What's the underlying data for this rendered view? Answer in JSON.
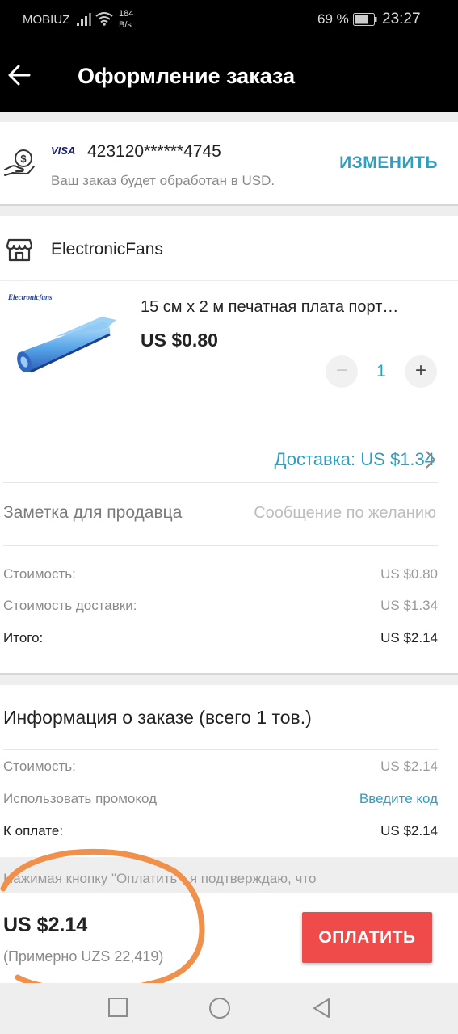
{
  "status_bar": {
    "carrier": "MOBIUZ",
    "speed_value": "184",
    "speed_unit": "B/s",
    "battery_percent": "69 %",
    "time": "23:27"
  },
  "header": {
    "title": "Оформление заказа",
    "back_icon": "arrow-left-icon"
  },
  "payment": {
    "card_brand": "VISA",
    "card_number": "423120******4745",
    "note": "Ваш заказ будет обработан в USD.",
    "change_label": "ИЗМЕНИТЬ",
    "icon": "hand-coin-icon"
  },
  "order": {
    "store_name": "ElectronicFans",
    "store_icon": "store-icon",
    "product": {
      "image_brand": "Electronicfans",
      "title": "15 см x 2 м печатная плата порт…",
      "price": "US $0.80",
      "quantity": "1",
      "minus": "−",
      "plus": "+"
    },
    "shipping": "Доставка: US $1.34",
    "seller_note": {
      "label": "Заметка для продавца",
      "placeholder": "Сообщение по желанию",
      "value": ""
    },
    "summary": [
      {
        "label": "Стоимость:",
        "value": "US $0.80"
      },
      {
        "label": "Стоимость доставки:",
        "value": "US $1.34"
      },
      {
        "label": "Итого:",
        "value": "US $2.14"
      }
    ]
  },
  "order_info": {
    "title": "Информация о заказе (всего 1 тов.)",
    "cost_label": "Стоимость:",
    "cost_value": "US $2.14",
    "promo_label": "Использовать промокод",
    "promo_link": "Введите код",
    "to_pay_label": "К оплате:",
    "to_pay_value": "US $2.14"
  },
  "terms_text": "Нажимая кнопку \"Оплатить\", я подтверждаю, что",
  "bottom_bar": {
    "total": "US $2.14",
    "approx": "(Примерно UZS 22,419)",
    "pay_label": "ОПЛАТИТЬ"
  },
  "colors": {
    "accent": "#2d9fc0",
    "pay_button": "#f04b4b",
    "annotation": "#f0904a"
  },
  "nav_bar": {
    "icons": [
      "recent-apps-icon",
      "home-icon",
      "back-triangle-icon"
    ]
  }
}
